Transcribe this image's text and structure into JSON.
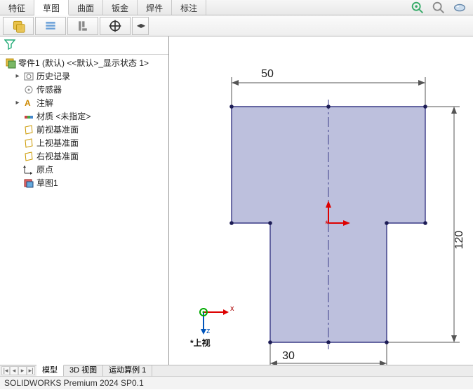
{
  "tabs_top": {
    "features": "特征",
    "sketch": "草图",
    "surface": "曲面",
    "sheetmetal": "钣金",
    "weldment": "焊件",
    "annotate": "标注"
  },
  "tree": {
    "root": "零件1 (默认) <<默认>_显示状态 1>",
    "history": "历史记录",
    "sensors": "传感器",
    "annotations": "注解",
    "material": "材质 <未指定>",
    "plane_front": "前视基准面",
    "plane_top": "上视基准面",
    "plane_right": "右视基准面",
    "origin": "原点",
    "sketch1": "草图1"
  },
  "dims": {
    "top_width": "50",
    "bottom_width": "30",
    "height": "120"
  },
  "triad": {
    "x": "x",
    "z": "z"
  },
  "view_label": "*上视",
  "bottom_tabs": {
    "model": "模型",
    "view3d": "3D 视图",
    "motion": "运动算例 1"
  },
  "status": "SOLIDWORKS Premium 2024 SP0.1",
  "chart_data": {
    "type": "diagram",
    "description": "2D sketch of a T-shaped profile on the Top plane",
    "dimensions": {
      "overall_height": 120,
      "top_bar_width": 50,
      "stem_width": 30
    }
  }
}
